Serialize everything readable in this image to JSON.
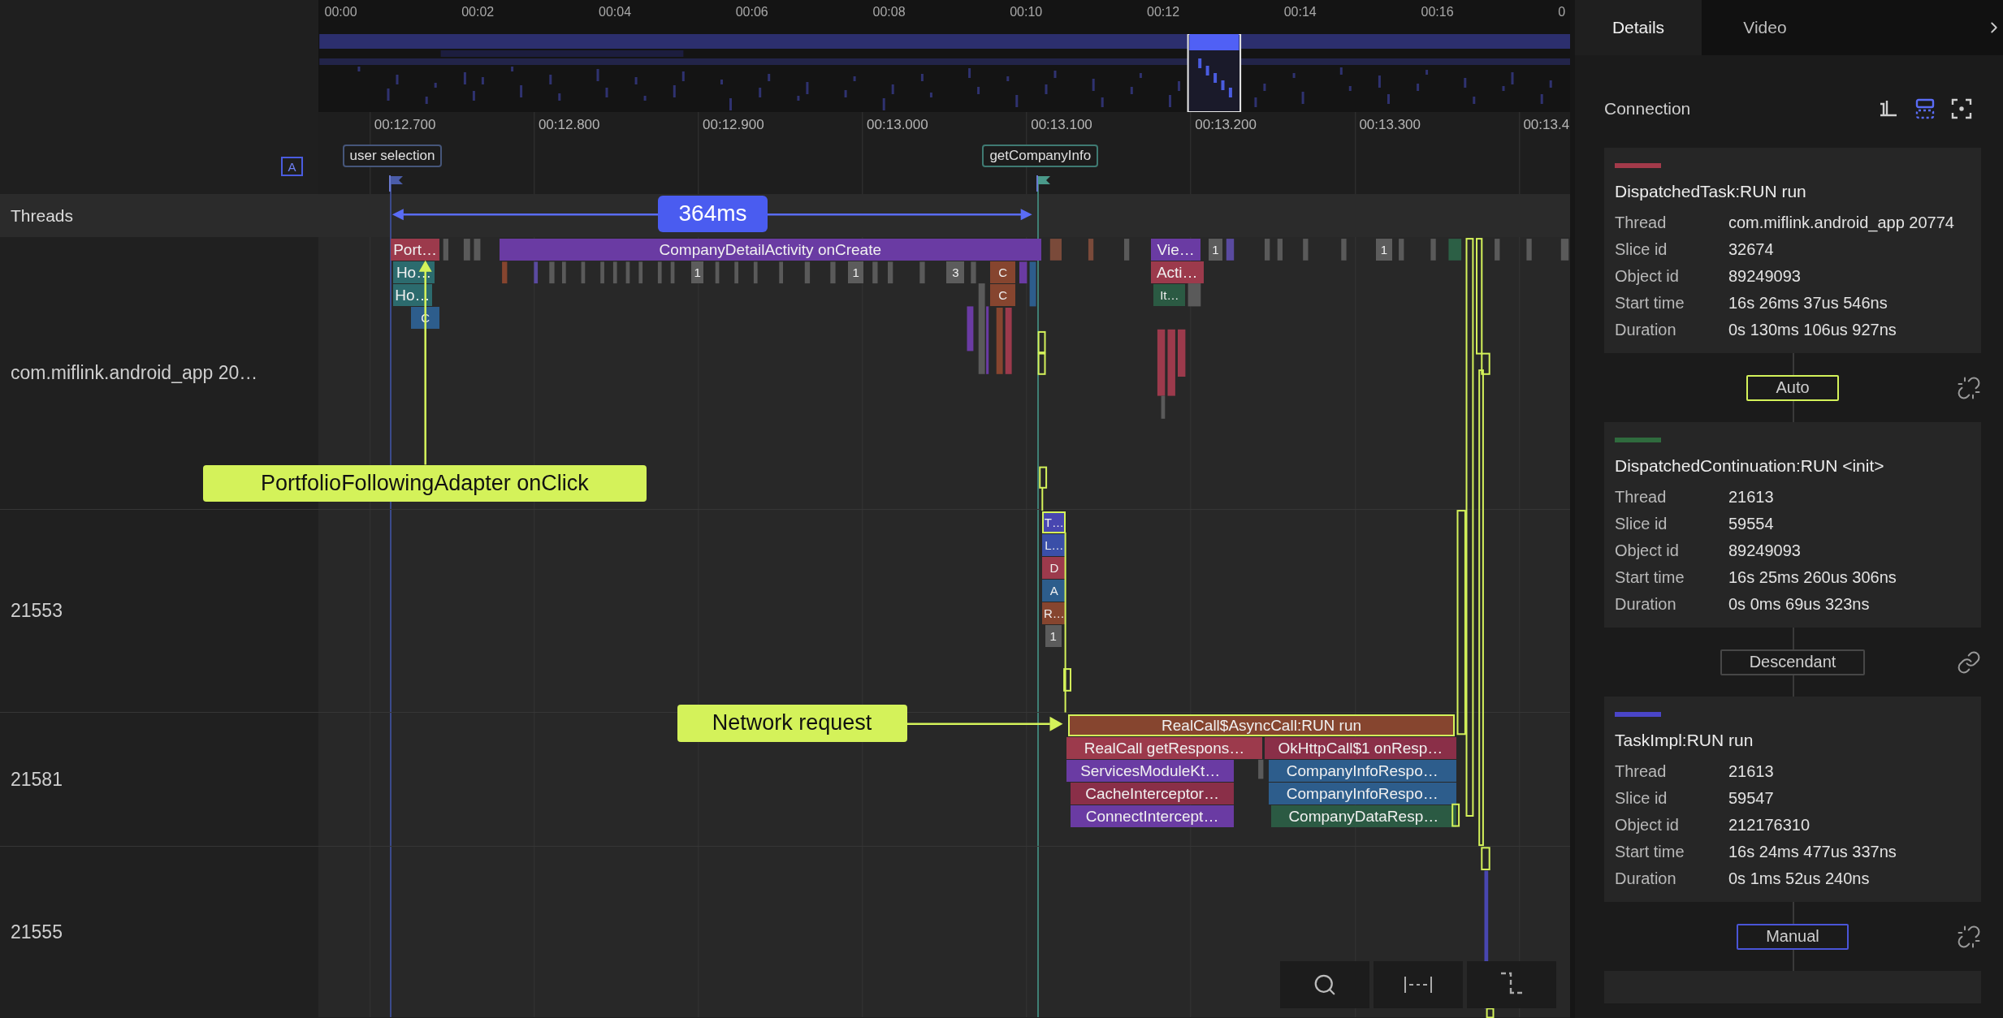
{
  "overview": {
    "ticks": [
      "00:00",
      "00:02",
      "00:04",
      "00:06",
      "00:08",
      "00:10",
      "00:12",
      "00:14",
      "00:16",
      "0"
    ]
  },
  "ruler": {
    "badge": "A",
    "ticks": [
      "00:12.700",
      "00:12.800",
      "00:12.900",
      "00:13.000",
      "00:13.100",
      "00:13.200",
      "00:13.300",
      "00:13.4"
    ]
  },
  "markers": [
    {
      "label": "user selection",
      "color": "#46567a"
    },
    {
      "label": "getCompanyInfo",
      "color": "#3f7a72"
    }
  ],
  "measurement": {
    "label": "364ms"
  },
  "threads_header": "Threads",
  "threads": [
    {
      "name": "com.miflink.android_app 20…",
      "slices": [
        {
          "label": "Port…",
          "color": "#9c3a4c",
          "highlighted": false
        },
        {
          "label": "CompanyDetailActivity onCreate",
          "color": "#6a3ba3",
          "highlighted": false
        },
        {
          "label": "Vie…",
          "color": "#6a3ba3",
          "highlighted": false
        },
        {
          "label": "1",
          "color": "#5c5c5c",
          "highlighted": false
        },
        {
          "label": "1",
          "color": "#5c5c5c",
          "highlighted": false
        },
        {
          "label": "Ho…",
          "color": "#2c6b6e",
          "highlighted": false
        },
        {
          "label": "1",
          "color": "#5c5c5c",
          "highlighted": false
        },
        {
          "label": "1",
          "color": "#5c5c5c",
          "highlighted": false
        },
        {
          "label": "3",
          "color": "#5c5c5c",
          "highlighted": false
        },
        {
          "label": "C",
          "color": "#86452f",
          "highlighted": false
        },
        {
          "label": "Acti…",
          "color": "#9c3a4c",
          "highlighted": false
        },
        {
          "label": "Ho…",
          "color": "#2c6b6e",
          "highlighted": false
        },
        {
          "label": "C",
          "color": "#86452f",
          "highlighted": false
        },
        {
          "label": "It…",
          "color": "#2b5a43",
          "highlighted": false
        },
        {
          "label": "C",
          "color": "#2d5d8c",
          "highlighted": false
        }
      ]
    },
    {
      "name": "21553",
      "slices": [
        {
          "label": "T…",
          "color": "#4846b0",
          "highlighted": true
        },
        {
          "label": "L…",
          "color": "#3a4fa8",
          "highlighted": false
        },
        {
          "label": "D",
          "color": "#9c3a4c",
          "highlighted": false
        },
        {
          "label": "A",
          "color": "#2d5d8c",
          "highlighted": false
        },
        {
          "label": "R…",
          "color": "#86452f",
          "highlighted": false
        },
        {
          "label": "1",
          "color": "#5c5c5c",
          "highlighted": false
        }
      ]
    },
    {
      "name": "21581",
      "slices": [
        {
          "label": "RealCall$AsyncCall:RUN run",
          "color": "#86452f",
          "highlighted": true
        },
        {
          "label": "RealCall getRespons…",
          "color": "#9c3a4c",
          "highlighted": false
        },
        {
          "label": "OkHttpCall$1 onResp…",
          "color": "#8a2f48",
          "highlighted": false
        },
        {
          "label": "ServicesModuleKt…",
          "color": "#6a3ba3",
          "highlighted": false
        },
        {
          "label": "CompanyInfoRespo…",
          "color": "#2d5d8c",
          "highlighted": false
        },
        {
          "label": "CacheInterceptor…",
          "color": "#8a2f48",
          "highlighted": false
        },
        {
          "label": "CompanyInfoRespo…",
          "color": "#2d5d8c",
          "highlighted": false
        },
        {
          "label": "ConnectIntercept…",
          "color": "#6a3ba3",
          "highlighted": false
        },
        {
          "label": "CompanyDataResp…",
          "color": "#2b5a43",
          "highlighted": false
        }
      ]
    },
    {
      "name": "21555"
    }
  ],
  "callouts": [
    {
      "text": "PortfolioFollowingAdapter onClick"
    },
    {
      "text": "Network request"
    }
  ],
  "panel": {
    "tabs": [
      {
        "label": "Details",
        "selected": true
      },
      {
        "label": "Video",
        "selected": false
      }
    ],
    "section": "Connection",
    "view_modes": [
      {
        "kind": "tree",
        "selected": false
      },
      {
        "kind": "split",
        "selected": true
      },
      {
        "kind": "focus",
        "selected": false
      }
    ],
    "chain": [
      {
        "kind": "card",
        "color": "#a33a4a",
        "title": "DispatchedTask:RUN run",
        "fields": [
          {
            "label": "Thread",
            "value": "com.miflink.android_app 20774"
          },
          {
            "label": "Slice id",
            "value": "32674"
          },
          {
            "label": "Object id",
            "value": "89249093"
          },
          {
            "label": "Start time",
            "value": "16s 26ms 37us 546ns"
          },
          {
            "label": "Duration",
            "value": "0s 130ms 106us 927ns"
          }
        ]
      },
      {
        "kind": "link",
        "label": "Auto",
        "linked": false
      },
      {
        "kind": "card",
        "color": "#2f6b3e",
        "title": "DispatchedContinuation:RUN <init>",
        "fields": [
          {
            "label": "Thread",
            "value": "21613"
          },
          {
            "label": "Slice id",
            "value": "59554"
          },
          {
            "label": "Object id",
            "value": "89249093"
          },
          {
            "label": "Start time",
            "value": "16s 25ms 260us 306ns"
          },
          {
            "label": "Duration",
            "value": "0s 0ms 69us 323ns"
          }
        ]
      },
      {
        "kind": "link",
        "label": "Descendant",
        "linked": true
      },
      {
        "kind": "card",
        "color": "#4a45c8",
        "title": "TaskImpl:RUN run",
        "fields": [
          {
            "label": "Thread",
            "value": "21613"
          },
          {
            "label": "Slice id",
            "value": "59547"
          },
          {
            "label": "Object id",
            "value": "212176310"
          },
          {
            "label": "Start time",
            "value": "16s 24ms 477us 337ns"
          },
          {
            "label": "Duration",
            "value": "0s 1ms 52us 240ns"
          }
        ]
      },
      {
        "kind": "link",
        "label": "Manual",
        "linked": false
      }
    ]
  }
}
